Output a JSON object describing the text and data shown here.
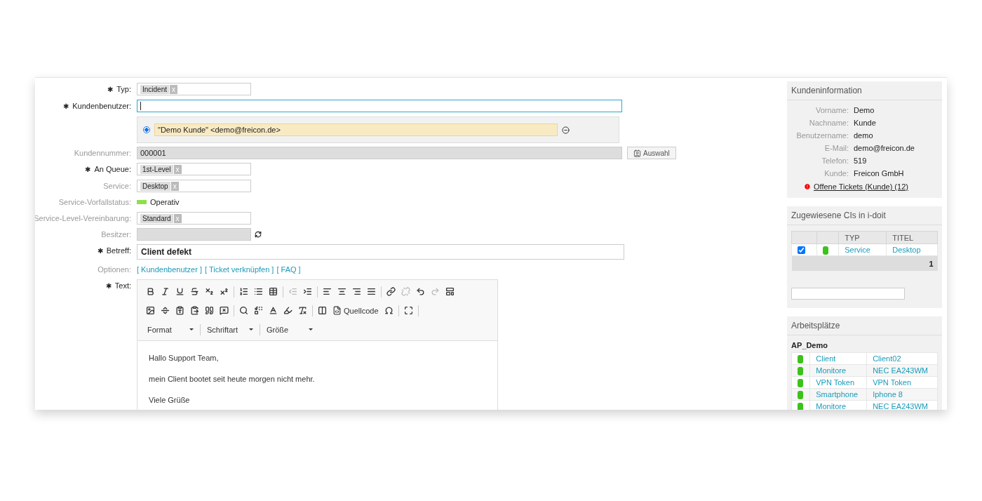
{
  "required_mark": "✱",
  "form": [
    {
      "kind": "tags",
      "label": "Typ:",
      "required": true,
      "tags": [
        "Incident"
      ],
      "remove": "x"
    },
    {
      "kind": "input",
      "label": "Kundenbenutzer:",
      "required": true,
      "focused": true
    },
    {
      "kind": "customers",
      "customers": [
        {
          "text": "\"Demo Kunde\" <demo@freicon.de>",
          "selected": true
        }
      ]
    },
    {
      "kind": "readonly",
      "label": "Kundennummer:",
      "required": false,
      "value": "000001",
      "button": "Auswahl"
    },
    {
      "kind": "tags",
      "label": "An Queue:",
      "required": true,
      "tags": [
        "1st-Level"
      ],
      "remove": "x"
    },
    {
      "kind": "tags",
      "label": "Service:",
      "required": false,
      "tags": [
        "Desktop"
      ],
      "remove": "x"
    },
    {
      "kind": "status",
      "label": "Service-Vorfallstatus:",
      "required": false,
      "value": "Operativ",
      "color": "#8ee04a"
    },
    {
      "kind": "tags",
      "label": "Service-Level-Vereinbarung:",
      "required": false,
      "tags": [
        "Standard"
      ],
      "remove": "x"
    },
    {
      "kind": "owner",
      "label": "Besitzer:",
      "required": false
    },
    {
      "kind": "subject",
      "label": "Betreff:",
      "required": true,
      "value": "Client defekt"
    },
    {
      "kind": "options",
      "label": "Optionen:",
      "required": false,
      "links": [
        "[ Kundenbenutzer ]",
        "[ Ticket verknüpfen ]",
        "[ FAQ ]"
      ]
    },
    {
      "kind": "editor",
      "label": "Text:",
      "required": true
    }
  ],
  "editor": {
    "toolbar": [
      [
        {
          "kind": "button",
          "disabled": false
        },
        {
          "kind": "button",
          "disabled": false
        },
        {
          "kind": "button",
          "disabled": false
        },
        {
          "kind": "button",
          "disabled": false
        },
        {
          "kind": "button",
          "disabled": false
        },
        {
          "kind": "button",
          "disabled": false
        },
        {
          "kind": "separator"
        },
        {
          "kind": "button",
          "disabled": false
        },
        {
          "kind": "button",
          "disabled": false
        },
        {
          "kind": "button",
          "disabled": false
        },
        {
          "kind": "separator"
        },
        {
          "kind": "button",
          "disabled": true
        },
        {
          "kind": "button",
          "disabled": false
        },
        {
          "kind": "separator"
        },
        {
          "kind": "button",
          "disabled": false
        },
        {
          "kind": "button",
          "disabled": false
        },
        {
          "kind": "button",
          "disabled": false
        },
        {
          "kind": "button",
          "disabled": false
        },
        {
          "kind": "separator"
        },
        {
          "kind": "button",
          "disabled": false
        },
        {
          "kind": "button",
          "disabled": true
        },
        {
          "kind": "button",
          "disabled": false
        },
        {
          "kind": "button",
          "disabled": true
        },
        {
          "kind": "button",
          "disabled": false
        }
      ],
      [
        {
          "kind": "button",
          "disabled": false
        },
        {
          "kind": "button",
          "disabled": false
        },
        {
          "kind": "button",
          "disabled": false
        },
        {
          "kind": "button",
          "disabled": false
        },
        {
          "kind": "button",
          "disabled": false
        },
        {
          "kind": "button",
          "disabled": false
        },
        {
          "kind": "separator"
        },
        {
          "kind": "button",
          "disabled": false
        },
        {
          "kind": "button",
          "disabled": false
        },
        {
          "kind": "button",
          "disabled": false
        },
        {
          "kind": "button",
          "disabled": false
        },
        {
          "kind": "button",
          "disabled": false
        },
        {
          "kind": "separator"
        },
        {
          "kind": "button",
          "disabled": false
        },
        {
          "kind": "labeled",
          "label": "Quellcode",
          "disabled": false
        },
        {
          "kind": "button",
          "disabled": false
        },
        {
          "kind": "separator"
        },
        {
          "kind": "button",
          "disabled": false
        },
        {
          "kind": "separator"
        }
      ]
    ],
    "dropdowns": [
      "Format",
      "Schriftart",
      "Größe"
    ],
    "paragraphs": [
      "Hallo Support Team,",
      "mein Client bootet seit heute morgen nicht mehr.",
      "Viele Grüße"
    ]
  },
  "customer_info": {
    "title": "Kundeninformation",
    "fields": [
      {
        "label": "Vorname:",
        "value": "Demo"
      },
      {
        "label": "Nachname:",
        "value": "Kunde"
      },
      {
        "label": "Benutzername:",
        "value": "demo"
      },
      {
        "label": "E-Mail:",
        "value": "demo@freicon.de"
      },
      {
        "label": "Telefon:",
        "value": "519"
      },
      {
        "label": "Kunde:",
        "value": "Freicon GmbH"
      }
    ],
    "open_tickets": "Offene Tickets (Kunde) (12)"
  },
  "cis": {
    "title": "Zugewiesene CIs in i-doit",
    "columns": [
      "TYP",
      "TITEL"
    ],
    "rows": [
      {
        "checked": true,
        "color": "#3cc21c",
        "type": "Service",
        "title": "Desktop"
      }
    ],
    "total": "1"
  },
  "workplaces": {
    "title": "Arbeitsplätze",
    "name": "AP_Demo",
    "rows": [
      {
        "color": "#3cc21c",
        "type": "Client",
        "title": "Client02"
      },
      {
        "color": "#3cc21c",
        "type": "Monitore",
        "title": "NEC EA243WM"
      },
      {
        "color": "#3cc21c",
        "type": "VPN Token",
        "title": "VPN Token"
      },
      {
        "color": "#3cc21c",
        "type": "Smartphone",
        "title": "Iphone 8"
      },
      {
        "color": "#3cc21c",
        "type": "Monitore",
        "title": "NEC EA243WM"
      }
    ]
  }
}
